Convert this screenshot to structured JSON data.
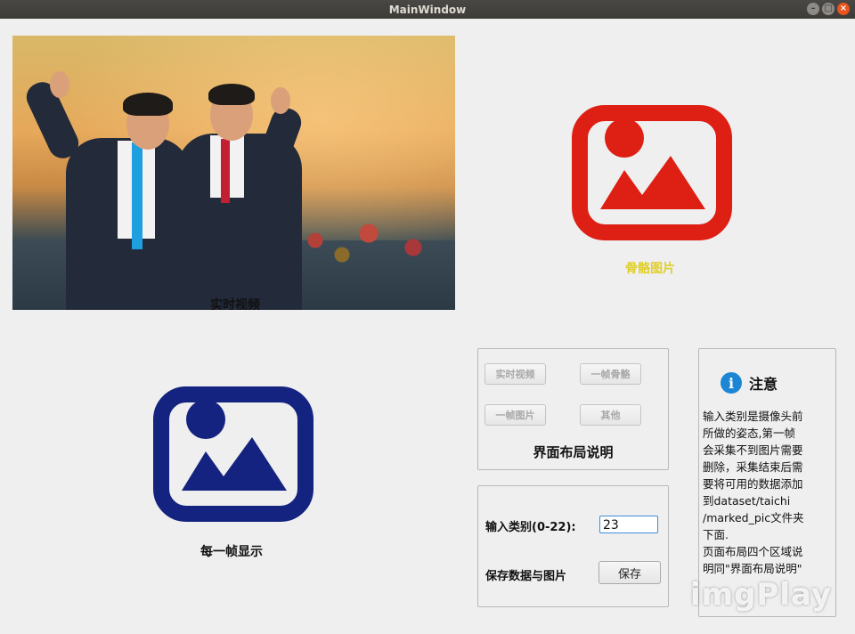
{
  "window": {
    "title": "MainWindow"
  },
  "video_panel": {
    "label": "实时视频"
  },
  "skeleton_panel": {
    "label": "骨骼图片",
    "icon": "image-placeholder-icon",
    "icon_color": "#dd1f14",
    "label_color": "#e0cf2a"
  },
  "frame_panel": {
    "label": "每一帧显示",
    "icon": "image-placeholder-icon",
    "icon_color": "#13237f"
  },
  "layout_group": {
    "buttons": [
      "实时视频",
      "一帧骨骼",
      "一帧图片",
      "其他"
    ],
    "caption": "界面布局说明"
  },
  "input_group": {
    "category_label": "输入类别(0-22):",
    "category_value": "23",
    "save_label": "保存数据与图片",
    "save_button": "保存"
  },
  "note": {
    "title": "注意",
    "lines": [
      "输入类别是摄像头前",
      "所做的姿态,第一帧",
      "会采集不到图片需要",
      "删除，采集结束后需",
      "要将可用的数据添加",
      "到dataset/taichi",
      "/marked_pic文件夹",
      "下面.",
      "页面布局四个区域说",
      "明同\"界面布局说明\""
    ]
  },
  "watermark": "imgPlay"
}
